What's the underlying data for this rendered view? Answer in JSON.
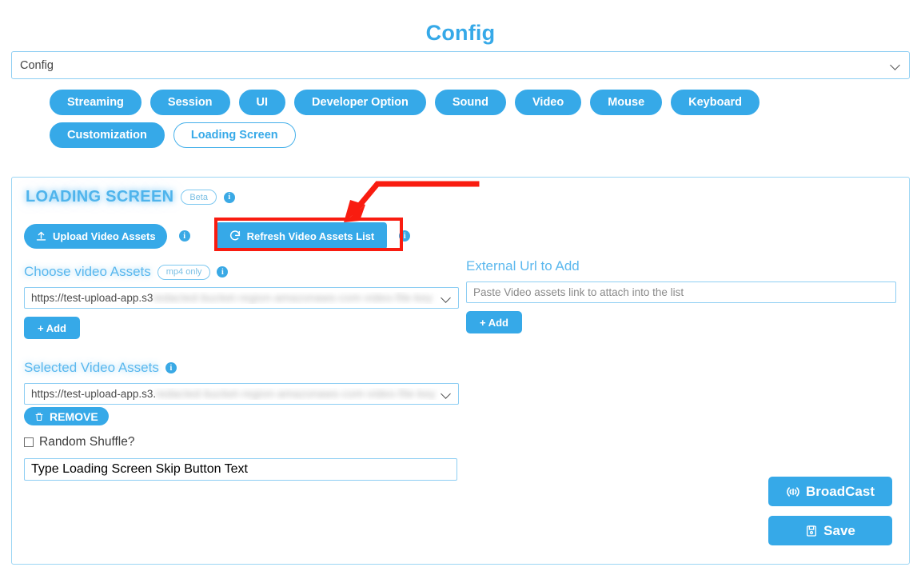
{
  "header": {
    "title": "Config"
  },
  "config_select": {
    "value": "Config",
    "chevron_icon": "chevron-down-icon"
  },
  "tabs": [
    {
      "label": "Streaming",
      "active": false
    },
    {
      "label": "Session",
      "active": false
    },
    {
      "label": "UI",
      "active": false
    },
    {
      "label": "Developer Option",
      "active": false
    },
    {
      "label": "Sound",
      "active": false
    },
    {
      "label": "Video",
      "active": false
    },
    {
      "label": "Mouse",
      "active": false
    },
    {
      "label": "Keyboard",
      "active": false
    },
    {
      "label": "Customization",
      "active": false
    },
    {
      "label": "Loading Screen",
      "active": true
    }
  ],
  "panel": {
    "section_title": "LOADING SCREEN",
    "section_badge": "Beta",
    "upload_button": {
      "label": "Upload Video Assets",
      "icon": "upload-icon"
    },
    "refresh_button": {
      "label": "Refresh Video Assets List",
      "icon": "refresh-icon"
    },
    "choose_assets": {
      "label": "Choose video Assets",
      "badge": "mp4 only",
      "value_visible": "https://test-upload-app.s3",
      "value_redacted": "redacted-bucket-region-amazonaws-com-video-file-key",
      "add_label": "+ Add"
    },
    "external_url": {
      "label": "External Url to Add",
      "placeholder": "Paste Video assets link to attach into the list",
      "value": "",
      "add_label": "+ Add"
    },
    "selected_assets": {
      "label": "Selected Video Assets",
      "value_visible": "https://test-upload-app.s3.",
      "value_redacted": "redacted-bucket-region-amazonaws-com-video-file-key",
      "remove_label": "REMOVE",
      "remove_icon": "trash-icon"
    },
    "random_shuffle": {
      "label": "Random Shuffle?",
      "checked": false
    },
    "skip_button_text": {
      "placeholder": "Type Loading Screen Skip Button Text",
      "value": ""
    },
    "broadcast_button": {
      "label": "BroadCast",
      "icon": "broadcast-tower-icon"
    },
    "save_button": {
      "label": "Save",
      "icon": "floppy-disk-icon"
    }
  },
  "annotation": {
    "type": "red-arrow-highlight",
    "target": "Refresh Video Assets List",
    "color": "#f91c10"
  },
  "colors": {
    "accent": "#36a9e8",
    "accent_light": "#5bb8ee",
    "border": "#8ecef3",
    "annotation_red": "#f91c10"
  }
}
